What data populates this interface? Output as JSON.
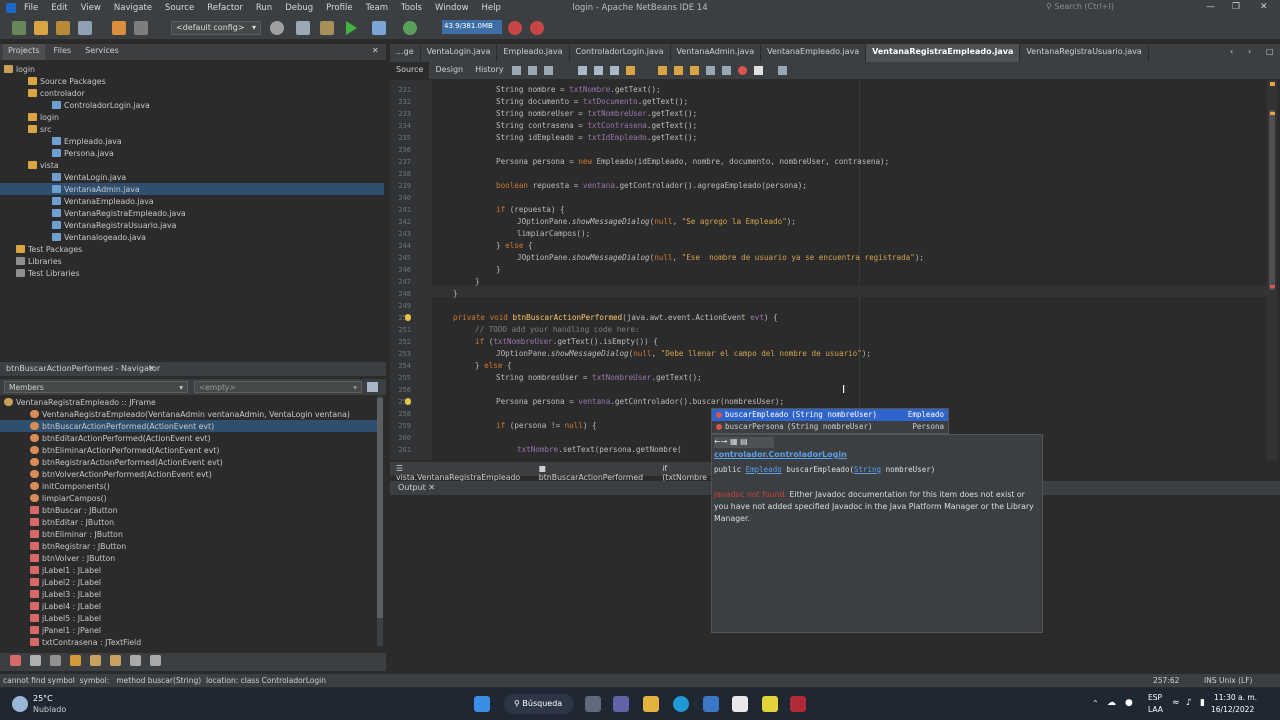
{
  "window": {
    "title": "login - Apache NetBeans IDE 14",
    "search_placeholder": "Search (Ctrl+I)",
    "menu": [
      "File",
      "Edit",
      "View",
      "Navigate",
      "Source",
      "Refactor",
      "Run",
      "Debug",
      "Profile",
      "Team",
      "Tools",
      "Window",
      "Help"
    ]
  },
  "toolbar": {
    "config": "<default config>",
    "memory": "43.9/381.0MB"
  },
  "left_tabs": [
    "Projects",
    "Files",
    "Services"
  ],
  "project_tree": [
    {
      "label": "login",
      "type": "proj"
    },
    {
      "label": "Source Packages",
      "type": "pkg"
    },
    {
      "label": "controlador",
      "type": "pkg"
    },
    {
      "label": "ControladorLogin.java",
      "type": "file"
    },
    {
      "label": "login",
      "type": "pkg"
    },
    {
      "label": "src",
      "type": "pkg"
    },
    {
      "label": "Empleado.java",
      "type": "file"
    },
    {
      "label": "Persona.java",
      "type": "file"
    },
    {
      "label": "vista",
      "type": "pkg"
    },
    {
      "label": "VentaLogin.java",
      "type": "file"
    },
    {
      "label": "VentanaAdmin.java",
      "type": "file"
    },
    {
      "label": "VentanaEmpleado.java",
      "type": "file"
    },
    {
      "label": "VentanaRegistraEmpleado.java",
      "type": "file"
    },
    {
      "label": "VentanaRegistraUsuario.java",
      "type": "file"
    },
    {
      "label": "Ventanalogeado.java",
      "type": "file"
    },
    {
      "label": "Test Packages",
      "type": "pkg"
    },
    {
      "label": "Libraries",
      "type": "lib"
    },
    {
      "label": "Test Libraries",
      "type": "lib"
    }
  ],
  "navigator": {
    "title": "btnBuscarActionPerformed - Navigator",
    "filter": "Members",
    "filter_value": "<empty>",
    "items": [
      "VentanaRegistraEmpleado :: JFrame",
      "VentanaRegistraEmpleado(VentanaAdmin ventanaAdmin, VentaLogin ventana)",
      "btnBuscarActionPerformed(ActionEvent evt)",
      "btnEditarActionPerformed(ActionEvent evt)",
      "btnEliminarActionPerformed(ActionEvent evt)",
      "btnRegistrarActionPerformed(ActionEvent evt)",
      "btnVolverActionPerformed(ActionEvent evt)",
      "initComponents()",
      "limpiarCampos()",
      "btnBuscar : JButton",
      "btnEditar : JButton",
      "btnEliminar : JButton",
      "btnRegistrar : JButton",
      "btnVolver : JButton",
      "jLabel1 : JLabel",
      "jLabel2 : JLabel",
      "jLabel3 : JLabel",
      "jLabel4 : JLabel",
      "jLabel5 : JLabel",
      "jPanel1 : JPanel",
      "txtContrasena : JTextField"
    ]
  },
  "editor_tabs": [
    "...ge",
    "VentaLogin.java",
    "Empleado.java",
    "ControladorLogin.java",
    "VentanaAdmin.java",
    "VentanaEmpleado.java",
    "VentanaRegistraEmpleado.java",
    "VentanaRegistraUsuario.java"
  ],
  "editor_modes": [
    "Source",
    "Design",
    "History"
  ],
  "line_numbers": [
    "231",
    "232",
    "233",
    "234",
    "235",
    "236",
    "237",
    "238",
    "239",
    "240",
    "241",
    "242",
    "243",
    "244",
    "245",
    "246",
    "247",
    "248",
    "249",
    "250",
    "251",
    "252",
    "253",
    "254",
    "255",
    "256",
    "257",
    "258",
    "259",
    "260",
    "261"
  ],
  "breadcrumb": [
    "vista.VentanaRegistraEmpleado",
    "btnBuscarActionPerformed",
    "if (txtNombre"
  ],
  "output": {
    "tab": "Output"
  },
  "completion": [
    {
      "name": "buscarEmpleado",
      "sig": "(String nombreUser)",
      "ret": "Empleado"
    },
    {
      "name": "buscarPersona",
      "sig": "(String nombreUser)",
      "ret": "Persona"
    }
  ],
  "javadoc": {
    "class_link": "controlador.ControladorLogin",
    "signature_pre": "public",
    "signature_type": "Empleado",
    "signature_name": "buscarEmpleado",
    "signature_param_type": "String",
    "signature_param": "nombreUser",
    "warn_label": "Javadoc not found.",
    "message": "Either Javadoc documentation for this item does not exist or you have not added specified Javadoc in the Java Platform Manager or the Library Manager."
  },
  "status": {
    "left": "cannot find symbol  symbol:   method buscar(String)  location: class ControladorLogin",
    "pos": "257:62",
    "mode": "INS Unix (LF)"
  },
  "taskbar": {
    "temp": "25°C",
    "weather": "Nublado",
    "search": "Búsqueda",
    "lang": "ESP",
    "layout": "LAA",
    "time": "11:30 a. m.",
    "date": "16/12/2022"
  }
}
